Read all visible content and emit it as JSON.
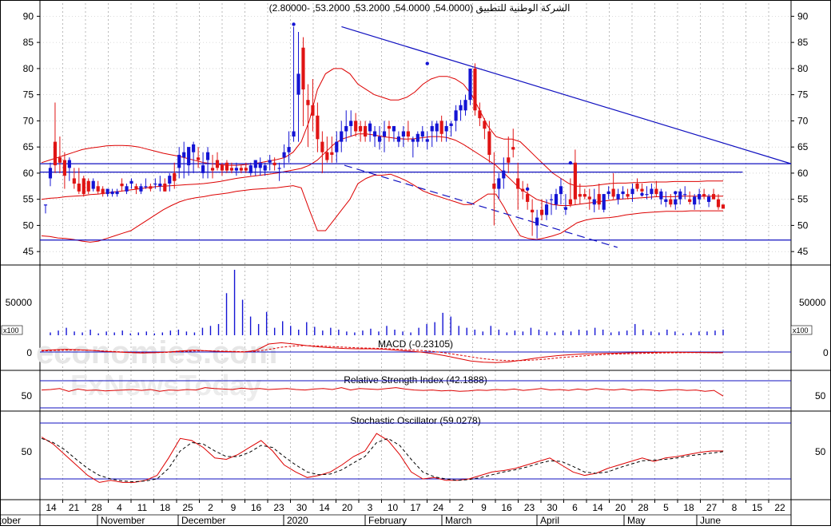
{
  "chart_data": {
    "type": "candlestick",
    "title": "الشركة الوطنية للتطبيق (54.0000, 54.0000, 53.2000, 53.2000, -2.80000)",
    "price_axis": {
      "ylim": [
        43.5,
        92.5
      ],
      "ticks": [
        45,
        50,
        55,
        60,
        65,
        70,
        75,
        80,
        85,
        90
      ]
    },
    "volume_axis": {
      "tick_label": "50000",
      "unit_label": "x100"
    },
    "x_tick_labels": [
      "14",
      "21",
      "28",
      "4",
      "11",
      "18",
      "25",
      "2",
      "9",
      "16",
      "23",
      "30",
      "14",
      "20",
      "3",
      "10",
      "17",
      "24",
      "2",
      "9",
      "16",
      "23",
      "30",
      "6",
      "14",
      "20",
      "28",
      "5",
      "18",
      "27",
      "8",
      "15",
      "22"
    ],
    "month_labels": [
      "October",
      "November",
      "December",
      "2020",
      "February",
      "March",
      "April",
      "May",
      "June"
    ],
    "candles": [
      [
        54,
        54,
        52.3,
        54
      ],
      [
        59,
        62,
        57.5,
        61
      ],
      [
        66,
        73.5,
        60,
        61.5
      ],
      [
        63,
        67,
        60,
        62
      ],
      [
        62.5,
        64,
        57,
        59.5
      ],
      [
        61,
        63,
        58.5,
        62.5
      ],
      [
        59,
        61,
        57,
        58
      ],
      [
        58,
        61,
        56,
        56.5
      ],
      [
        59,
        59.5,
        55.5,
        56
      ],
      [
        58.5,
        59,
        56,
        56.5
      ],
      [
        57,
        59,
        56.5,
        58.5
      ],
      [
        57.5,
        58.5,
        56,
        56.5
      ],
      [
        57,
        57.5,
        55.5,
        56
      ],
      [
        56,
        57,
        55.5,
        57
      ],
      [
        56,
        57,
        55.5,
        56.5
      ],
      [
        56,
        57,
        55.5,
        56.5
      ],
      [
        58,
        59,
        56.5,
        57.5
      ],
      [
        56.5,
        58,
        56,
        57.5
      ],
      [
        58,
        59,
        57,
        58.5
      ],
      [
        57.5,
        58,
        56,
        57
      ],
      [
        56.5,
        58,
        56,
        57.5
      ],
      [
        57.5,
        59,
        57,
        57.5
      ],
      [
        57.5,
        58,
        56.5,
        57
      ],
      [
        58,
        59,
        57,
        58
      ],
      [
        57.5,
        59.5,
        56.5,
        58
      ],
      [
        58,
        59,
        56.5,
        56.5
      ],
      [
        58,
        60,
        56.5,
        59.5
      ],
      [
        60,
        62,
        57,
        58.5
      ],
      [
        61,
        65,
        59,
        63.5
      ],
      [
        63,
        66,
        59,
        64
      ],
      [
        61.5,
        65,
        59.5,
        65
      ],
      [
        64,
        66,
        60,
        65.5
      ],
      [
        63,
        65,
        61,
        62.5
      ],
      [
        60,
        64,
        59,
        61.5
      ],
      [
        62.5,
        65,
        59,
        64
      ],
      [
        61,
        63.5,
        59,
        60.5
      ],
      [
        62.5,
        64,
        60.5,
        61
      ],
      [
        61.5,
        62,
        59.5,
        60.5
      ],
      [
        62,
        62.5,
        60,
        60.5
      ],
      [
        61,
        62,
        60,
        60.5
      ],
      [
        60.5,
        62,
        59.5,
        61
      ],
      [
        61,
        61.5,
        60,
        60.5
      ],
      [
        61,
        62,
        60,
        60.5
      ],
      [
        60,
        62,
        59.5,
        61.5
      ],
      [
        61,
        62.5,
        59.5,
        62.5
      ],
      [
        61,
        63,
        59.5,
        62
      ],
      [
        60.5,
        62,
        59.5,
        61.5
      ],
      [
        62,
        63.5,
        60.5,
        62.5
      ],
      [
        62,
        63,
        60.5,
        61.5
      ],
      [
        61,
        62,
        58.5,
        61
      ],
      [
        63,
        65.5,
        61,
        64
      ],
      [
        64,
        68,
        62,
        65
      ],
      [
        67,
        88,
        66,
        68
      ],
      [
        75,
        87,
        66,
        79
      ],
      [
        84,
        86,
        69,
        76
      ],
      [
        74,
        77,
        65,
        73
      ],
      [
        73,
        78,
        68,
        71
      ],
      [
        71,
        73.5,
        64,
        66.5
      ],
      [
        66,
        68,
        60,
        64
      ],
      [
        64,
        67,
        62,
        62.5
      ],
      [
        64,
        67,
        62,
        63.5
      ],
      [
        64,
        68,
        62,
        66
      ],
      [
        66,
        70,
        64,
        68
      ],
      [
        68,
        72,
        66,
        69
      ],
      [
        69,
        72,
        67,
        70
      ],
      [
        70,
        71.5,
        67,
        68
      ],
      [
        69,
        70,
        66,
        68
      ],
      [
        69,
        70,
        66,
        67
      ],
      [
        68,
        70,
        66,
        69.5
      ],
      [
        67,
        69,
        65,
        68
      ],
      [
        66,
        69,
        64.5,
        67
      ],
      [
        67,
        70,
        64,
        68
      ],
      [
        69,
        70,
        66,
        68.5
      ],
      [
        68,
        69,
        66,
        69
      ],
      [
        66,
        68,
        65,
        67
      ],
      [
        67,
        69,
        65,
        68
      ],
      [
        68,
        70,
        66,
        67
      ],
      [
        66,
        67,
        63,
        66.5
      ],
      [
        66,
        68,
        65,
        67.5
      ],
      [
        67,
        69,
        66,
        68
      ],
      [
        66,
        68,
        64.5,
        66.5
      ],
      [
        68,
        70,
        65,
        69
      ],
      [
        68,
        70,
        66,
        69.5
      ],
      [
        70,
        71,
        66,
        67.5
      ],
      [
        68,
        70,
        66,
        69
      ],
      [
        69,
        70,
        67,
        69.5
      ],
      [
        70,
        73,
        68,
        72
      ],
      [
        72,
        74,
        70,
        73
      ],
      [
        72,
        75,
        71,
        74
      ],
      [
        74,
        80,
        73,
        80
      ],
      [
        80,
        81,
        71,
        72
      ],
      [
        72,
        73.5,
        69,
        70.5
      ],
      [
        70,
        70.5,
        66.5,
        68.5
      ],
      [
        68,
        70,
        62,
        63.5
      ],
      [
        58,
        64,
        50,
        57
      ],
      [
        57,
        60,
        55,
        59
      ],
      [
        59,
        63,
        57,
        60.5
      ],
      [
        63,
        67,
        60,
        62
      ],
      [
        65,
        68.5,
        63,
        64.5
      ],
      [
        59,
        62,
        53,
        57
      ],
      [
        57,
        58.5,
        55,
        56.5
      ],
      [
        56,
        58,
        53,
        54.5
      ],
      [
        53,
        55,
        48,
        52.5
      ],
      [
        50,
        53,
        47.5,
        51.5
      ],
      [
        53,
        55,
        51,
        52
      ],
      [
        52,
        55,
        51,
        54
      ],
      [
        55,
        56,
        52,
        55
      ],
      [
        54,
        57,
        53,
        56
      ],
      [
        56,
        59,
        54,
        57.5
      ],
      [
        53,
        56,
        52,
        53.5
      ],
      [
        55,
        59,
        53.5,
        54
      ],
      [
        62,
        64.5,
        54,
        55
      ],
      [
        56,
        58,
        54,
        55.5
      ],
      [
        56,
        57,
        55,
        55.5
      ],
      [
        55.5,
        57,
        53,
        55
      ],
      [
        54,
        57,
        52.5,
        55
      ],
      [
        56,
        58,
        53,
        54
      ],
      [
        53,
        56,
        52.5,
        56
      ],
      [
        56,
        57.5,
        55,
        56.5
      ],
      [
        57,
        60,
        55,
        55.5
      ],
      [
        55,
        57,
        54,
        56
      ],
      [
        56,
        57.5,
        55,
        56.5
      ],
      [
        56,
        57,
        55,
        55.5
      ],
      [
        56,
        58,
        54.5,
        57
      ],
      [
        58,
        59,
        56.5,
        57
      ],
      [
        57,
        58,
        55.5,
        56.5
      ],
      [
        56,
        57.5,
        55,
        56
      ],
      [
        56,
        58,
        55,
        57
      ],
      [
        57,
        58.5,
        55.5,
        56
      ],
      [
        55,
        57,
        54,
        56.5
      ],
      [
        54.5,
        56.5,
        53.5,
        55
      ],
      [
        55,
        56,
        53.5,
        54
      ],
      [
        54,
        56,
        53,
        55
      ],
      [
        55,
        57,
        54,
        56.5
      ],
      [
        56,
        57.5,
        55,
        56
      ],
      [
        55,
        56.5,
        54,
        54.5
      ],
      [
        54,
        56,
        53,
        55.5
      ],
      [
        55,
        57,
        54,
        56
      ],
      [
        56,
        57,
        55,
        55.5
      ],
      [
        54.5,
        56,
        53.5,
        55.5
      ],
      [
        56,
        57,
        55,
        55
      ],
      [
        55,
        56,
        53,
        53.5
      ],
      [
        54,
        54,
        53.2,
        53.2
      ]
    ],
    "bollinger": {
      "middle": [
        55,
        55.2,
        55.3,
        55.5,
        55.6,
        55.7,
        55.9,
        56,
        56.2,
        56.4,
        56.6,
        56.8,
        57,
        57.2,
        57.4,
        57.5,
        57.6,
        57.7,
        57.8,
        57.9,
        58,
        58.2,
        58.4,
        58.7,
        59,
        59.2,
        59.4,
        59.6,
        59.8,
        60,
        60.3,
        60.6,
        60.9,
        61.5,
        62.5,
        64,
        65.5,
        66.5,
        67,
        67.5,
        67.5,
        67.3,
        67,
        66.8,
        66.6,
        66.5,
        66.6,
        66.8,
        67,
        67,
        66.8,
        66.3,
        65.5,
        64.5,
        63.5,
        62.5,
        61.5,
        60,
        58.5,
        57,
        56,
        55,
        54.5,
        54,
        53.8,
        53.8,
        54,
        54.2,
        54.4,
        54.6,
        54.8,
        55,
        55.1,
        55.2,
        55.3,
        55.4,
        55.5,
        55.5,
        55.5,
        55.6,
        55.6,
        55.6,
        55.6,
        55.6,
        55.6
      ],
      "upper": [
        62,
        62.5,
        63,
        63.5,
        64,
        64.5,
        64.8,
        65,
        65.2,
        65.3,
        65.3,
        65.2,
        65,
        64.6,
        64.2,
        63.8,
        63.5,
        63.2,
        62.8,
        62.4,
        62,
        61.8,
        61.6,
        61.5,
        61.5,
        61.6,
        61.8,
        62,
        62.3,
        62.6,
        63,
        64,
        66,
        70,
        76,
        79,
        80,
        80,
        79,
        77,
        76,
        75,
        74.5,
        74,
        74,
        74.5,
        75.5,
        77,
        78,
        78.5,
        78.5,
        78,
        77,
        75,
        72,
        69,
        67,
        66.5,
        66.5,
        66,
        64.5,
        63,
        61.5,
        60,
        59,
        58,
        57.5,
        57.5,
        57.6,
        57.8,
        58,
        58.1,
        58.1,
        58.2,
        58.2,
        58.3,
        58.3,
        58.3,
        58.4,
        58.4,
        58.4,
        58.4,
        58.5,
        58.5,
        58.5
      ],
      "lower": [
        48,
        47.9,
        47.6,
        47.5,
        47.3,
        47,
        46.8,
        47,
        47.5,
        48,
        48.5,
        49,
        50,
        51,
        52,
        53,
        53.8,
        54.5,
        55,
        55.3,
        55.5,
        55.8,
        56,
        56.2,
        56.5,
        56.7,
        56.9,
        57,
        57.1,
        57.2,
        57.4,
        57.6,
        57.2,
        53,
        49,
        49,
        51,
        53,
        55,
        58,
        59,
        59.6,
        59.6,
        59.8,
        59.2,
        58.5,
        57.6,
        56.6,
        56,
        55.5,
        55,
        54.5,
        54,
        54,
        55,
        56,
        56,
        53.5,
        50.5,
        48,
        47.5,
        47.3,
        47.6,
        48,
        48.5,
        49.5,
        50.5,
        51,
        51.3,
        51.4,
        51.5,
        51.7,
        52,
        52.2,
        52.4,
        52.5,
        52.6,
        52.7,
        52.7,
        52.7,
        52.8,
        52.8,
        52.8,
        52.8,
        52.8
      ]
    },
    "trendlines": [
      {
        "style": "solid",
        "from": [
          "2020-01-21",
          88
        ],
        "to": [
          "2020-06-27",
          61.8
        ]
      },
      {
        "style": "solid",
        "from": [
          "2019-10-07",
          61.8
        ],
        "to": [
          "2020-06-27",
          61.8
        ]
      },
      {
        "style": "solid",
        "from": [
          "2019-10-07",
          47.2
        ],
        "to": [
          "2020-06-27",
          47.2
        ]
      },
      {
        "style": "solid",
        "from": [
          "2019-10-07",
          60.2
        ],
        "to": [
          "2020-06-10",
          60.2
        ]
      },
      {
        "style": "dashed",
        "from": [
          "2020-01-22",
          61.5
        ],
        "to": [
          "2020-04-27",
          45.8
        ]
      }
    ],
    "volume": [
      3,
      5,
      8,
      4,
      3,
      6,
      2,
      4,
      3,
      5,
      2,
      3,
      4,
      2,
      3,
      5,
      6,
      4,
      3,
      8,
      10,
      12,
      45,
      70,
      38,
      20,
      12,
      25,
      8,
      15,
      10,
      6,
      14,
      9,
      5,
      8,
      6,
      4,
      3,
      5,
      7,
      4,
      10,
      6,
      4,
      3,
      8,
      12,
      14,
      24,
      20,
      10,
      8,
      6,
      4,
      10,
      6,
      3,
      5,
      4,
      8,
      6,
      4,
      3,
      5,
      4,
      6,
      5,
      8,
      6,
      3,
      4,
      5,
      12,
      6,
      4,
      3,
      6,
      4,
      2,
      3,
      4,
      4,
      5,
      6
    ],
    "indicators": [
      {
        "name": "MACD (-0.23105)",
        "yticks": [
          "0"
        ]
      },
      {
        "name": "Relative Strength Index (42.1888)",
        "yticks": [
          "50"
        ]
      },
      {
        "name": "Stochastic Oscillator (59.0278)",
        "yticks": [
          "50"
        ]
      }
    ],
    "macd": [
      0.5,
      0.7,
      0.8,
      0.7,
      0.5,
      0.2,
      0,
      -0.2,
      -0.3,
      -0.2,
      0,
      0.3,
      0.6,
      0.4,
      0.2,
      0.1,
      0,
      0.5,
      2.5,
      2.9,
      2.5,
      2,
      1.6,
      1.3,
      1.1,
      1,
      1,
      0.9,
      0.6,
      0.3,
      0,
      -0.5,
      -1.2,
      -2,
      -2.8,
      -3.2,
      -3.3,
      -3.1,
      -2.6,
      -2,
      -1.5,
      -1.1,
      -0.8,
      -0.6,
      -0.5,
      -0.4,
      -0.3,
      -0.2,
      -0.15,
      -0.1,
      -0.08,
      -0.1,
      -0.15,
      -0.2,
      -0.23
    ],
    "macd_signal": [
      0.3,
      0.5,
      0.6,
      0.6,
      0.5,
      0.3,
      0.1,
      -0.1,
      -0.2,
      -0.2,
      -0.1,
      0.1,
      0.3,
      0.4,
      0.3,
      0.2,
      0.1,
      0.2,
      0.8,
      1.5,
      1.9,
      2,
      1.9,
      1.7,
      1.5,
      1.3,
      1.2,
      1.1,
      0.9,
      0.7,
      0.5,
      0.2,
      -0.3,
      -0.9,
      -1.5,
      -2.1,
      -2.5,
      -2.7,
      -2.7,
      -2.5,
      -2.2,
      -1.8,
      -1.5,
      -1.2,
      -0.9,
      -0.7,
      -0.6,
      -0.5,
      -0.4,
      -0.3,
      -0.25,
      -0.2,
      -0.2,
      -0.2,
      -0.22
    ],
    "rsi": [
      55,
      56,
      58,
      52,
      57,
      54,
      55,
      53,
      54,
      55,
      56,
      54,
      56,
      52,
      55,
      54,
      56,
      55,
      60,
      58,
      57,
      56,
      59,
      57,
      58,
      56,
      57,
      58,
      56,
      55,
      57,
      58,
      56,
      60,
      55,
      58,
      57,
      56,
      58,
      60,
      57,
      55,
      54,
      55,
      53,
      54,
      52,
      53,
      55,
      54,
      56,
      55,
      57,
      54,
      56,
      58,
      55,
      56,
      54,
      57,
      55,
      58,
      56,
      55,
      57,
      54,
      56,
      55,
      53,
      55,
      56,
      54,
      55,
      52,
      54,
      42
    ],
    "stoch_k": [
      80,
      70,
      55,
      40,
      25,
      15,
      18,
      15,
      15,
      18,
      25,
      50,
      78,
      75,
      65,
      50,
      48,
      55,
      65,
      75,
      60,
      40,
      30,
      22,
      25,
      30,
      40,
      52,
      60,
      85,
      75,
      55,
      30,
      20,
      22,
      18,
      18,
      20,
      25,
      30,
      32,
      35,
      40,
      45,
      50,
      40,
      30,
      25,
      28,
      35,
      40,
      45,
      50,
      45,
      50,
      52,
      55,
      58,
      60,
      60
    ],
    "stoch_d": [
      78,
      72,
      62,
      48,
      35,
      25,
      20,
      17,
      16,
      17,
      20,
      35,
      60,
      72,
      70,
      60,
      52,
      52,
      58,
      68,
      65,
      52,
      40,
      30,
      26,
      27,
      33,
      43,
      52,
      72,
      78,
      68,
      48,
      30,
      23,
      20,
      18,
      19,
      22,
      26,
      30,
      33,
      37,
      42,
      46,
      45,
      38,
      30,
      28,
      30,
      36,
      41,
      46,
      47,
      48,
      50,
      53,
      55,
      57,
      59
    ]
  }
}
